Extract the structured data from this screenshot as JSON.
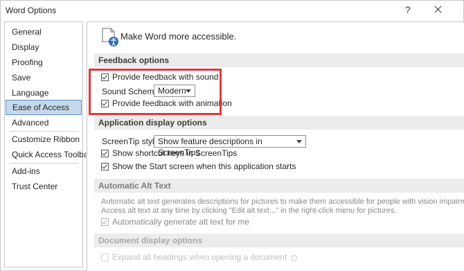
{
  "window": {
    "title": "Word Options",
    "help_label": "?",
    "close_label": "close"
  },
  "sidebar": {
    "items": [
      {
        "label": "General"
      },
      {
        "label": "Display"
      },
      {
        "label": "Proofing"
      },
      {
        "label": "Save"
      },
      {
        "label": "Language"
      },
      {
        "label": "Ease of Access",
        "selected": true
      },
      {
        "label": "Advanced"
      },
      {
        "label": "Customize Ribbon"
      },
      {
        "label": "Quick Access Toolbar"
      },
      {
        "label": "Add-ins"
      },
      {
        "label": "Trust Center"
      }
    ]
  },
  "content": {
    "intro": "Make Word more accessible.",
    "feedback": {
      "header": "Feedback options",
      "sound_label": "Provide feedback with sound",
      "sound_checked": true,
      "scheme_label": "Sound Scheme:",
      "scheme_value": "Modern",
      "animation_label": "Provide feedback with animation",
      "animation_checked": true
    },
    "app_display": {
      "header": "Application display options",
      "screentip_label": "ScreenTip style:",
      "screentip_value": "Show feature descriptions in ScreenTips",
      "shortcut_label": "Show shortcut keys in ScreenTips",
      "shortcut_checked": true,
      "startscreen_label": "Show the Start screen when this application starts",
      "startscreen_checked": true
    },
    "alt_text": {
      "header": "Automatic Alt Text",
      "desc_line1": "Automatic alt text generates descriptions for pictures to make them accessible for people with vision impairments.",
      "desc_line2": "Access alt text at any time by clicking \"Edit alt text...\" in the right-click menu for pictures.",
      "auto_label": "Automatically generate alt text for me",
      "auto_checked": true
    },
    "doc_display": {
      "header": "Document display options",
      "expand_label": "Expand all headings when opening a document",
      "expand_checked": false
    }
  },
  "colors": {
    "selected_bg": "#c5d9ed",
    "selected_border": "#5b8fc7",
    "highlight_border": "#e0373f",
    "section_bg": "#ececec"
  }
}
